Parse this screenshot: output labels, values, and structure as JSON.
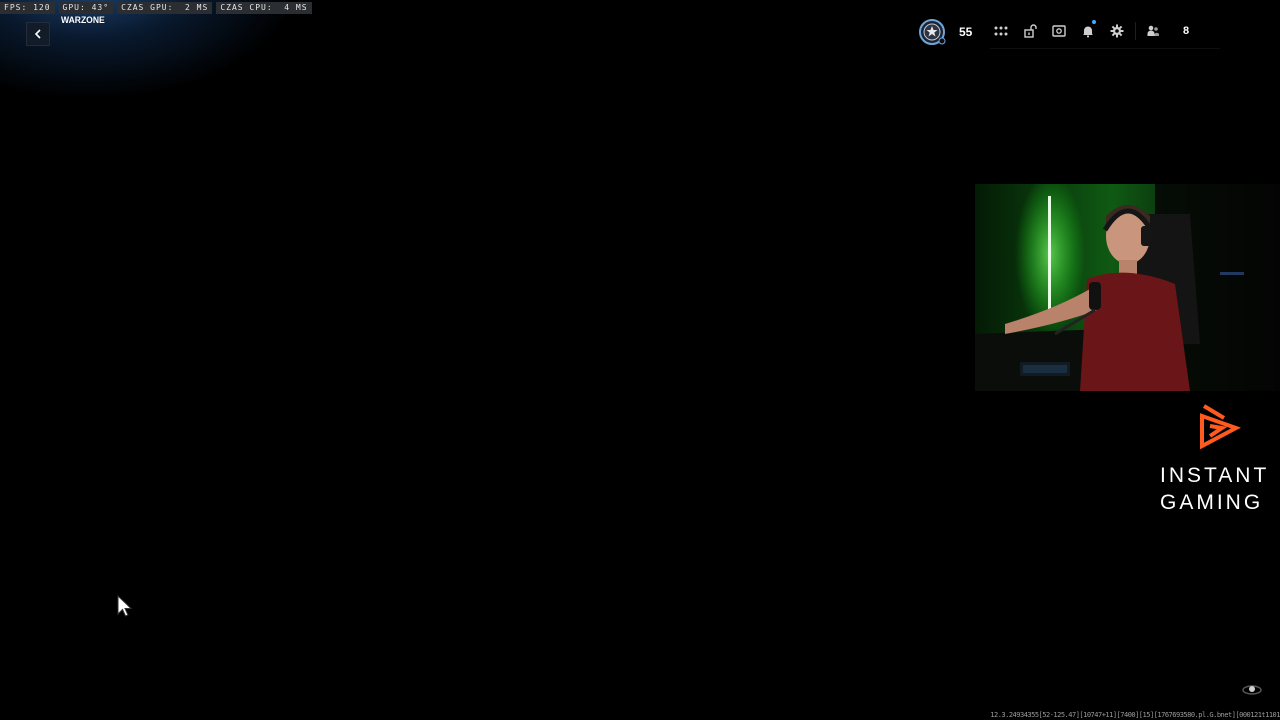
{
  "performance": {
    "fps": "FPS: 120",
    "gpu": "GPU: 43°",
    "gpu_time": "CZAS GPU:  2 MS",
    "cpu_time": "CZAS CPU:  4 MS"
  },
  "header": {
    "game_title": "WARZONE",
    "back_icon": "chevron-left-icon"
  },
  "hud": {
    "rank_icon": "rank-badge-icon",
    "level": "55",
    "icons": [
      "grid-menu-icon",
      "unlock-icon",
      "camera-icon",
      "bell-icon",
      "gear-icon",
      "party-icon"
    ],
    "party_count": "8",
    "notification_color": "#4aa8ff"
  },
  "sponsor": {
    "line1": "INSTANT",
    "line2": "GAMING",
    "accent_color": "#ff5a1f"
  },
  "footer": {
    "debug_string": "12.3.24934355[52-125.47][10747+11][7400][15][1767693580.pl.G.bnet][000121t1101",
    "status_icon": "loading-icon"
  }
}
